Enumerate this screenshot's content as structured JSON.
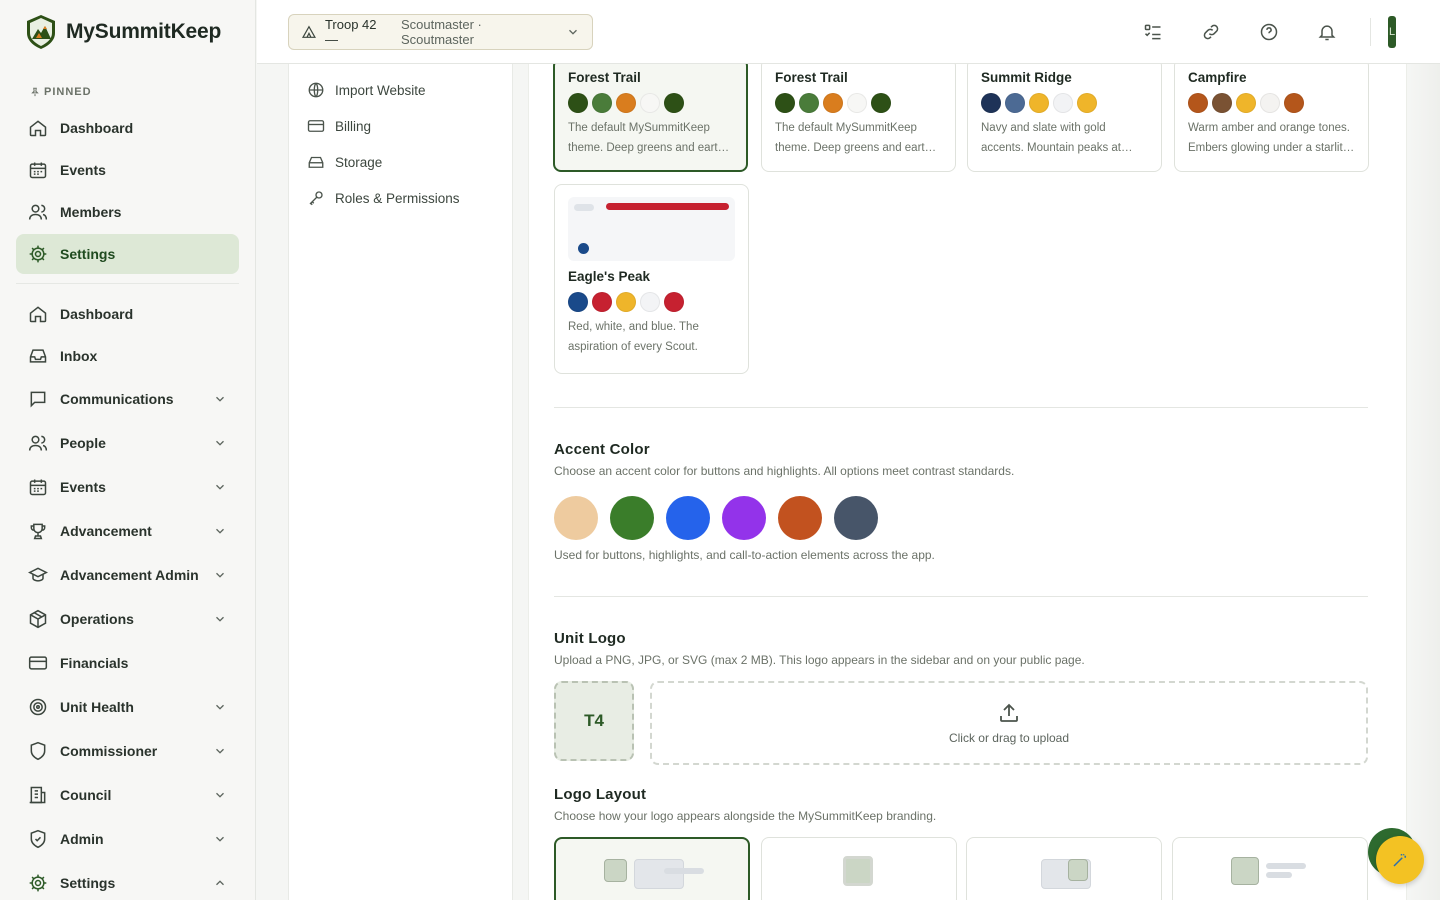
{
  "brand": {
    "name": "MySummitKeep"
  },
  "sidebar": {
    "pinned_label": "PINNED",
    "pinned": [
      {
        "label": "Dashboard",
        "icon": "home-icon"
      },
      {
        "label": "Events",
        "icon": "calendar-icon"
      },
      {
        "label": "Members",
        "icon": "users-icon"
      },
      {
        "label": "Settings",
        "icon": "gear-icon",
        "active": true
      }
    ],
    "items": [
      {
        "label": "Dashboard",
        "icon": "home-icon"
      },
      {
        "label": "Inbox",
        "icon": "inbox-icon"
      },
      {
        "label": "Communications",
        "icon": "message-icon",
        "chevron": "down"
      },
      {
        "label": "People",
        "icon": "users-icon",
        "chevron": "down"
      },
      {
        "label": "Events",
        "icon": "calendar-icon",
        "chevron": "down"
      },
      {
        "label": "Advancement",
        "icon": "trophy-icon",
        "chevron": "down"
      },
      {
        "label": "Advancement Admin",
        "icon": "graduation-cap-icon",
        "chevron": "down"
      },
      {
        "label": "Operations",
        "icon": "package-icon",
        "chevron": "down"
      },
      {
        "label": "Financials",
        "icon": "credit-card-icon"
      },
      {
        "label": "Unit Health",
        "icon": "target-icon",
        "chevron": "down"
      },
      {
        "label": "Commissioner",
        "icon": "shield-icon",
        "chevron": "down"
      },
      {
        "label": "Council",
        "icon": "building-icon",
        "chevron": "down"
      },
      {
        "label": "Admin",
        "icon": "shield-check-icon",
        "chevron": "down"
      },
      {
        "label": "Settings",
        "icon": "gear-icon",
        "chevron": "up"
      }
    ]
  },
  "topbar": {
    "troop_name": "Troop 42 —",
    "troop_role": "Scoutmaster · Scoutmaster",
    "icons": [
      "checklist-icon",
      "link-icon",
      "help-icon",
      "bell-icon"
    ],
    "avatar_initial": "L"
  },
  "subnav": {
    "items": [
      {
        "label": "Import Website",
        "icon": "globe-icon"
      },
      {
        "label": "Billing",
        "icon": "credit-card-icon"
      },
      {
        "label": "Storage",
        "icon": "hard-drive-icon"
      },
      {
        "label": "Roles & Permissions",
        "icon": "key-icon"
      }
    ]
  },
  "themes": [
    {
      "name": "Forest Trail",
      "desc": "The default MySummitKeep theme. Deep greens and earth tones.",
      "colors": [
        "#2d5016",
        "#4a7c3a",
        "#d97d1e",
        "#f7f7f5",
        "#2d5016"
      ],
      "selected": true
    },
    {
      "name": "Forest Trail",
      "desc": "The default MySummitKeep theme. Deep greens and earth tones.",
      "colors": [
        "#2d5016",
        "#4a7c3a",
        "#d97d1e",
        "#f7f7f5",
        "#2d5016"
      ]
    },
    {
      "name": "Summit Ridge",
      "desc": "Navy and slate with gold accents. Mountain peaks at dawn.",
      "colors": [
        "#1e3358",
        "#4c6a94",
        "#efb52a",
        "#f2f3f5",
        "#efb52a"
      ]
    },
    {
      "name": "Campfire",
      "desc": "Warm amber and orange tones. Embers glowing under a starlit sky.",
      "colors": [
        "#b4561b",
        "#7a5233",
        "#efb52a",
        "#f4f3f1",
        "#b4561b"
      ]
    },
    {
      "name": "Eagle's Peak",
      "desc": "Red, white, and blue. The aspiration of every Scout.",
      "colors": [
        "#1a4a8a",
        "#c62130",
        "#efb52a",
        "#f3f4f6",
        "#c62130"
      ]
    }
  ],
  "accent": {
    "title": "Accent Color",
    "subtitle": "Choose an accent color for buttons and highlights. All options meet contrast standards.",
    "colors": [
      "#eecb9f",
      "#3a7d2a",
      "#2563eb",
      "#9333ea",
      "#c2521f",
      "#475569"
    ],
    "note": "Used for buttons, highlights, and call-to-action elements across the app."
  },
  "unit_logo": {
    "title": "Unit Logo",
    "subtitle": "Upload a PNG, JPG, or SVG (max 2 MB). This logo appears in the sidebar and on your public page.",
    "initials": "T4",
    "upload_text": "Click or drag to upload"
  },
  "logo_layout": {
    "title": "Logo Layout",
    "subtitle": "Choose how your logo appears alongside the MySummitKeep branding."
  },
  "fab": {
    "icon": "wand-icon"
  }
}
